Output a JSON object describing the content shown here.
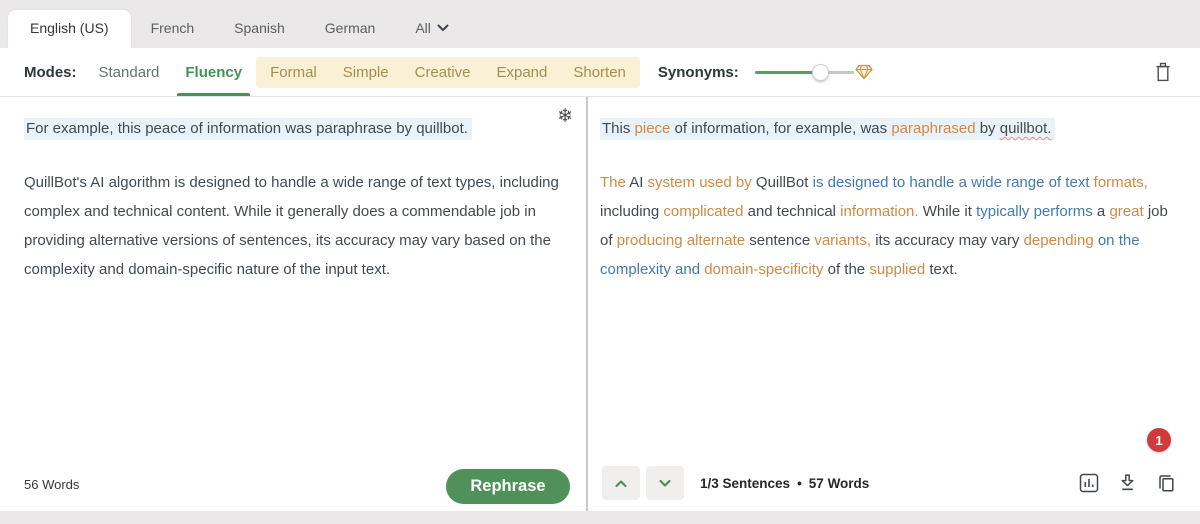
{
  "tabs": {
    "items": [
      {
        "label": "English (US)",
        "active": true
      },
      {
        "label": "French",
        "active": false
      },
      {
        "label": "Spanish",
        "active": false
      },
      {
        "label": "German",
        "active": false
      },
      {
        "label": "All",
        "active": false,
        "has_dropdown": true
      }
    ]
  },
  "toolbar": {
    "modes_label": "Modes:",
    "standard_label": "Standard",
    "fluency_label": "Fluency",
    "active_mode": "Fluency",
    "premium_modes": [
      "Formal",
      "Simple",
      "Creative",
      "Expand",
      "Shorten"
    ],
    "synonyms_label": "Synonyms:",
    "synonyms_slider_percent": 62
  },
  "icons": {
    "snowflake": "❄"
  },
  "input": {
    "sentence": "For example, this peace of information was paraphrase by quillbot.",
    "paragraph": "QuillBot's AI algorithm is designed to handle a wide range of text types, including complex and technical content. While it generally does a commendable job in providing alternative versions of sentences, its accuracy may vary based on the complexity and domain-specific nature of the input text.",
    "word_count": "56 Words",
    "rephrase_label": "Rephrase"
  },
  "output": {
    "sentence_segments": [
      {
        "text": "This ",
        "color": "plain"
      },
      {
        "text": "piece",
        "color": "orange"
      },
      {
        "text": " of information, for example, was ",
        "color": "plain"
      },
      {
        "text": "paraphrased",
        "color": "orange"
      },
      {
        "text": " by ",
        "color": "plain"
      },
      {
        "text": "quillbot.",
        "color": "plain",
        "spell": true
      }
    ],
    "paragraph_segments": [
      {
        "text": "The ",
        "color": "orange"
      },
      {
        "text": "AI ",
        "color": "plain"
      },
      {
        "text": "system used by ",
        "color": "orange"
      },
      {
        "text": "QuillBot ",
        "color": "plain"
      },
      {
        "text": "is designed to handle a wide range of text ",
        "color": "blue"
      },
      {
        "text": "formats,",
        "color": "orange"
      },
      {
        "text": " including ",
        "color": "plain"
      },
      {
        "text": "complicated",
        "color": "orange"
      },
      {
        "text": " and technical ",
        "color": "plain"
      },
      {
        "text": "information.",
        "color": "orange"
      },
      {
        "text": " While it ",
        "color": "plain"
      },
      {
        "text": "typically performs",
        "color": "blue"
      },
      {
        "text": " a ",
        "color": "plain"
      },
      {
        "text": "great",
        "color": "orange"
      },
      {
        "text": " job of ",
        "color": "plain"
      },
      {
        "text": "producing alternate",
        "color": "orange"
      },
      {
        "text": " sentence ",
        "color": "plain"
      },
      {
        "text": "variants,",
        "color": "orange"
      },
      {
        "text": " its accuracy may vary ",
        "color": "plain"
      },
      {
        "text": "depending",
        "color": "orange"
      },
      {
        "text": " on the complexity and ",
        "color": "blue"
      },
      {
        "text": "domain-specificity",
        "color": "orange"
      },
      {
        "text": " of the ",
        "color": "plain"
      },
      {
        "text": "supplied",
        "color": "orange"
      },
      {
        "text": " text.",
        "color": "plain"
      }
    ],
    "badge_count": "1",
    "sentence_counter": "1/3 Sentences",
    "separator": "•",
    "word_count": "57 Words"
  },
  "colors": {
    "brand_green": "#4f9158",
    "changed_word_orange": "#cf8a45",
    "structural_blue": "#4379b2",
    "premium_bg": "#faf0d6",
    "premium_text": "#a3904e",
    "sentence_highlight": "#e9f2f9",
    "badge_red": "#d13b3b"
  }
}
